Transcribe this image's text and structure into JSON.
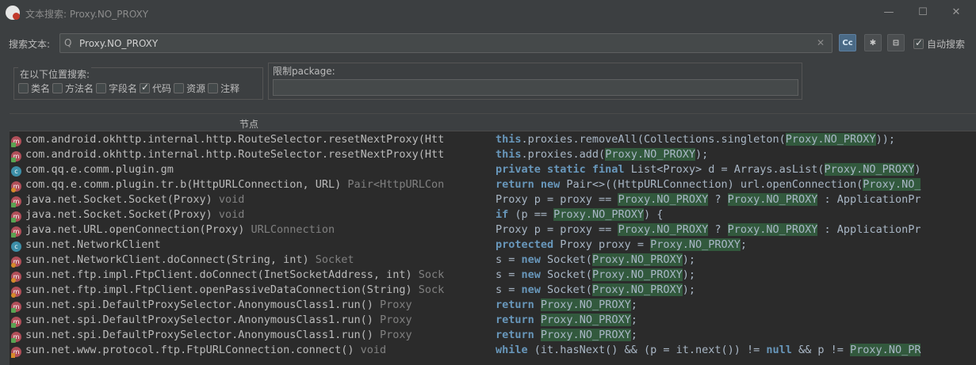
{
  "window": {
    "title": "文本搜索: Proxy.NO_PROXY",
    "controls": [
      "—",
      "☐",
      "✕"
    ]
  },
  "search": {
    "label": "搜索文本:",
    "value": "Proxy.NO_PROXY",
    "glass": "Q",
    "clear": "✕",
    "case_btn": "Cc",
    "regex_btn": "✱",
    "pkg_btn": "⊟",
    "auto_label": "自动搜索",
    "auto_checked": true
  },
  "scope": {
    "title": "在以下位置搜索:",
    "options": [
      {
        "label": "类名",
        "checked": false
      },
      {
        "label": "方法名",
        "checked": false
      },
      {
        "label": "字段名",
        "checked": false
      },
      {
        "label": "代码",
        "checked": true
      },
      {
        "label": "资源",
        "checked": false
      },
      {
        "label": "注释",
        "checked": false
      }
    ]
  },
  "package": {
    "title": "限制package:",
    "value": ""
  },
  "results": {
    "header": "节点",
    "rows": [
      {
        "icon": "method-icon",
        "node": "com.android.okhttp.internal.http.RouteSelector.resetNextProxy(Htt",
        "ret": "",
        "code": [
          [
            "kwb",
            "this"
          ],
          [
            "txt",
            ".proxies.removeAll(Collections.singleton("
          ],
          [
            "hl",
            "Proxy.NO_PROXY"
          ],
          [
            "txt",
            "));"
          ]
        ]
      },
      {
        "icon": "method-icon",
        "node": "com.android.okhttp.internal.http.RouteSelector.resetNextProxy(Htt",
        "ret": "",
        "code": [
          [
            "kwb",
            "this"
          ],
          [
            "txt",
            ".proxies.add("
          ],
          [
            "hl",
            "Proxy.NO_PROXY"
          ],
          [
            "txt",
            ");"
          ]
        ]
      },
      {
        "icon": "class-icon",
        "node": "com.qq.e.comm.plugin.gm",
        "ret": "",
        "code": [
          [
            "kwb",
            "private static final"
          ],
          [
            "txt",
            " List<Proxy> d = Arrays.asList("
          ],
          [
            "hl",
            "Proxy.NO_PROXY"
          ],
          [
            "txt",
            ")"
          ]
        ]
      },
      {
        "icon": "method-icon",
        "node": "com.qq.e.comm.plugin.tr.b(HttpURLConnection, URL)",
        "ret": " Pair<HttpURLCon",
        "code": [
          [
            "kwb",
            "return new"
          ],
          [
            "txt",
            " Pair<>((HttpURLConnection) url.openConnection("
          ],
          [
            "hl",
            "Proxy.NO_"
          ]
        ]
      },
      {
        "icon": "method-icon",
        "node": "java.net.Socket.Socket(Proxy)",
        "ret": " void",
        "code": [
          [
            "txt",
            "Proxy p = proxy == "
          ],
          [
            "hl",
            "Proxy.NO_PROXY"
          ],
          [
            "txt",
            " ? "
          ],
          [
            "hl",
            "Proxy.NO_PROXY"
          ],
          [
            "txt",
            " : ApplicationPr"
          ]
        ]
      },
      {
        "icon": "method-icon",
        "node": "java.net.Socket.Socket(Proxy)",
        "ret": " void",
        "code": [
          [
            "kwb",
            "if"
          ],
          [
            "txt",
            " (p == "
          ],
          [
            "hl",
            "Proxy.NO_PROXY"
          ],
          [
            "txt",
            ") {"
          ]
        ]
      },
      {
        "icon": "method-icon",
        "node": "java.net.URL.openConnection(Proxy)",
        "ret": " URLConnection",
        "code": [
          [
            "txt",
            "Proxy p = proxy == "
          ],
          [
            "hl",
            "Proxy.NO_PROXY"
          ],
          [
            "txt",
            " ? "
          ],
          [
            "hl",
            "Proxy.NO_PROXY"
          ],
          [
            "txt",
            " : ApplicationPr"
          ]
        ]
      },
      {
        "icon": "class-icon",
        "node": "sun.net.NetworkClient",
        "ret": "",
        "code": [
          [
            "kwb",
            "protected"
          ],
          [
            "txt",
            " Proxy proxy = "
          ],
          [
            "hl",
            "Proxy.NO_PROXY"
          ],
          [
            "txt",
            ";"
          ]
        ]
      },
      {
        "icon": "method-icon",
        "node": "sun.net.NetworkClient.doConnect(String, int)",
        "ret": " Socket",
        "code": [
          [
            "txt",
            "s = "
          ],
          [
            "kwb",
            "new"
          ],
          [
            "txt",
            " Socket("
          ],
          [
            "hl",
            "Proxy.NO_PROXY"
          ],
          [
            "txt",
            ");"
          ]
        ]
      },
      {
        "icon": "method-icon",
        "node": "sun.net.ftp.impl.FtpClient.doConnect(InetSocketAddress, int)",
        "ret": " Sock",
        "code": [
          [
            "txt",
            "s = "
          ],
          [
            "kwb",
            "new"
          ],
          [
            "txt",
            " Socket("
          ],
          [
            "hl",
            "Proxy.NO_PROXY"
          ],
          [
            "txt",
            ");"
          ]
        ]
      },
      {
        "icon": "method-icon",
        "node": "sun.net.ftp.impl.FtpClient.openPassiveDataConnection(String)",
        "ret": " Sock",
        "code": [
          [
            "txt",
            "s = "
          ],
          [
            "kwb",
            "new"
          ],
          [
            "txt",
            " Socket("
          ],
          [
            "hl",
            "Proxy.NO_PROXY"
          ],
          [
            "txt",
            ");"
          ]
        ]
      },
      {
        "icon": "method-icon",
        "node": "sun.net.spi.DefaultProxySelector.AnonymousClass1.run()",
        "ret": " Proxy",
        "code": [
          [
            "kwb",
            "return"
          ],
          [
            "txt",
            " "
          ],
          [
            "hl",
            "Proxy.NO_PROXY"
          ],
          [
            "txt",
            ";"
          ]
        ]
      },
      {
        "icon": "method-icon",
        "node": "sun.net.spi.DefaultProxySelector.AnonymousClass1.run()",
        "ret": " Proxy",
        "code": [
          [
            "kwb",
            "return"
          ],
          [
            "txt",
            " "
          ],
          [
            "hl",
            "Proxy.NO_PROXY"
          ],
          [
            "txt",
            ";"
          ]
        ]
      },
      {
        "icon": "method-icon",
        "node": "sun.net.spi.DefaultProxySelector.AnonymousClass1.run()",
        "ret": " Proxy",
        "code": [
          [
            "kwb",
            "return"
          ],
          [
            "txt",
            " "
          ],
          [
            "hl",
            "Proxy.NO_PROXY"
          ],
          [
            "txt",
            ";"
          ]
        ]
      },
      {
        "icon": "method-icon",
        "node": "sun.net.www.protocol.ftp.FtpURLConnection.connect()",
        "ret": " void",
        "code": [
          [
            "kwb",
            "while"
          ],
          [
            "txt",
            " (it.hasNext() && (p = it.next()) != "
          ],
          [
            "kwb",
            "null"
          ],
          [
            "txt",
            " && p != "
          ],
          [
            "hl",
            "Proxy.NO_PR"
          ]
        ]
      }
    ]
  }
}
